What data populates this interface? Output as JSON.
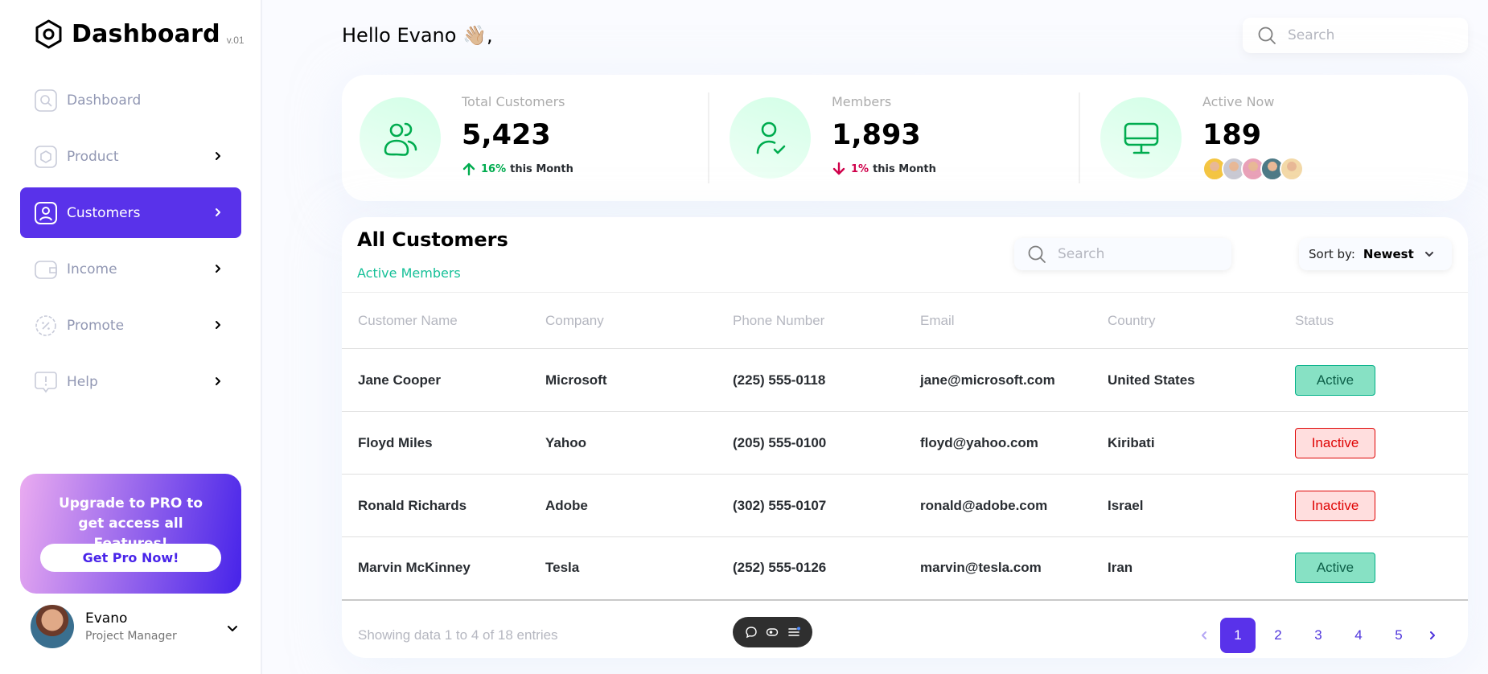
{
  "brand": {
    "title": "Dashboard",
    "version": "v.01"
  },
  "sidebar": {
    "items": [
      {
        "label": "Dashboard",
        "icon": "key-icon",
        "has_chevron": false,
        "active": false
      },
      {
        "label": "Product",
        "icon": "cube-icon",
        "has_chevron": true,
        "active": false
      },
      {
        "label": "Customers",
        "icon": "user-square-icon",
        "has_chevron": true,
        "active": true
      },
      {
        "label": "Income",
        "icon": "wallet-icon",
        "has_chevron": true,
        "active": false
      },
      {
        "label": "Promote",
        "icon": "discount-icon",
        "has_chevron": true,
        "active": false
      },
      {
        "label": "Help",
        "icon": "message-question-icon",
        "has_chevron": true,
        "active": false
      }
    ],
    "upgrade": {
      "text": "Upgrade to PRO to get access all Features!",
      "button": "Get Pro Now!"
    },
    "profile": {
      "name": "Evano",
      "role": "Project Manager"
    }
  },
  "header": {
    "greeting": "Hello Evano 👋🏼,",
    "search_placeholder": "Search"
  },
  "stats": [
    {
      "label": "Total Customers",
      "value": "5,423",
      "trend_dir": "up",
      "trend_pct": "16%",
      "trend_suffix": "this Month",
      "icon": "users-icon"
    },
    {
      "label": "Members",
      "value": "1,893",
      "trend_dir": "down",
      "trend_pct": "1%",
      "trend_suffix": "this Month",
      "icon": "user-tick-icon"
    },
    {
      "label": "Active Now",
      "value": "189",
      "icon": "monitor-icon",
      "avatar_colors": [
        "#f4c542",
        "#c9c9d3",
        "#e9a1b8",
        "#4d7a86",
        "#f3d9a8"
      ]
    }
  ],
  "customers": {
    "title": "All Customers",
    "subtitle": "Active Members",
    "search_placeholder": "Search",
    "sort_label": "Sort by:",
    "sort_value": "Newest",
    "columns": [
      "Customer Name",
      "Company",
      "Phone Number",
      "Email",
      "Country",
      "Status"
    ],
    "rows": [
      [
        "Jane Cooper",
        "Microsoft",
        "(225) 555-0118",
        "jane@microsoft.com",
        "United States",
        "Active"
      ],
      [
        "Floyd Miles",
        "Yahoo",
        "(205) 555-0100",
        "floyd@yahoo.com",
        "Kiribati",
        "Inactive"
      ],
      [
        "Ronald Richards",
        "Adobe",
        "(302) 555-0107",
        "ronald@adobe.com",
        "Israel",
        "Inactive"
      ],
      [
        "Marvin McKinney",
        "Tesla",
        "(252) 555-0126",
        "marvin@tesla.com",
        "Iran",
        "Active"
      ]
    ],
    "showing": "Showing data 1 to 4 of 18 entries",
    "pages": [
      "1",
      "2",
      "3",
      "4",
      "5"
    ],
    "current_page": "1"
  },
  "colors": {
    "accent": "#5932ea",
    "green": "#00ac4f",
    "red": "#d0004b",
    "teal": "#16c098"
  }
}
